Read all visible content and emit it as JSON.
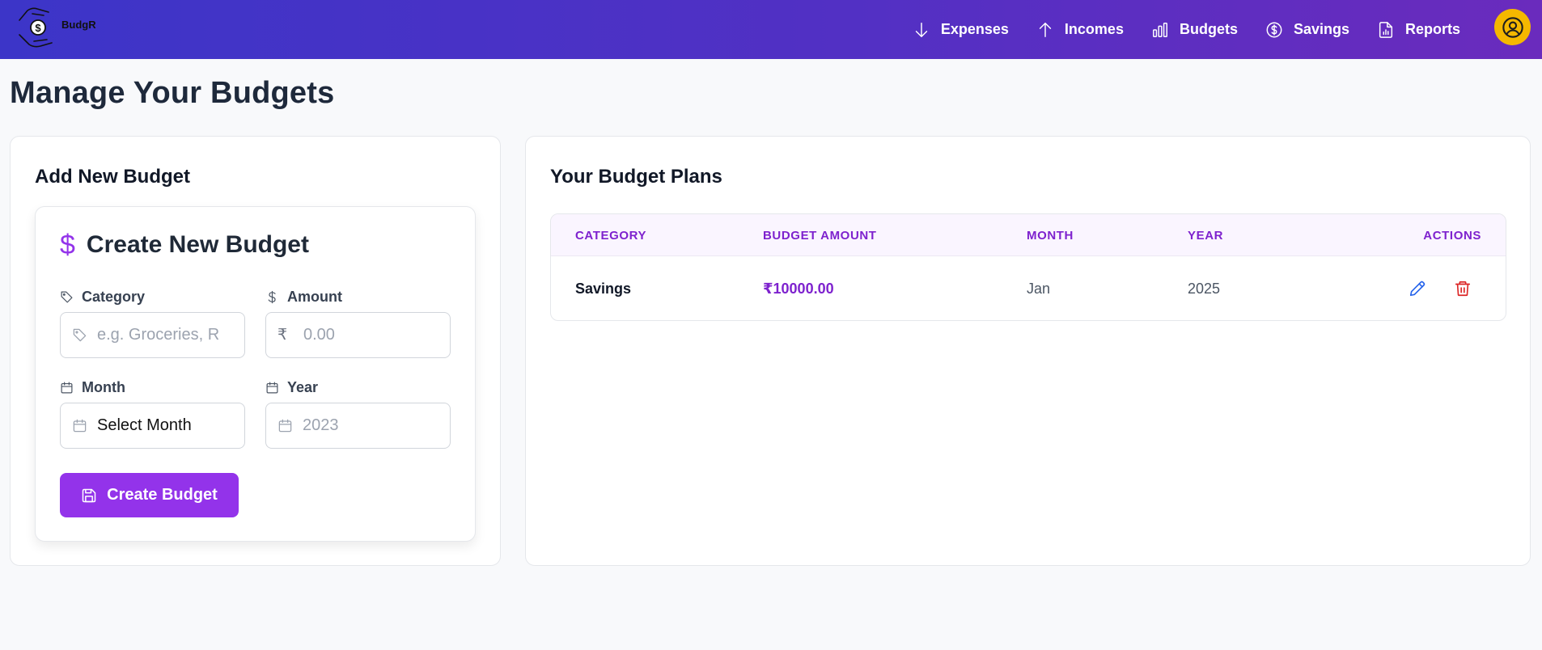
{
  "brand": {
    "name": "BudgR"
  },
  "nav": {
    "items": [
      {
        "label": "Expenses",
        "icon": "arrow-down-icon"
      },
      {
        "label": "Incomes",
        "icon": "arrow-up-icon"
      },
      {
        "label": "Budgets",
        "icon": "bar-chart-icon"
      },
      {
        "label": "Savings",
        "icon": "dollar-circle-icon"
      },
      {
        "label": "Reports",
        "icon": "report-file-icon"
      }
    ],
    "avatar_icon": "user-circle-icon"
  },
  "page": {
    "title": "Manage Your Budgets"
  },
  "add_budget": {
    "heading": "Add New Budget",
    "form": {
      "title_icon": "$",
      "title": "Create New Budget",
      "category": {
        "label": "Category",
        "placeholder": "e.g. Groceries, Rent",
        "value": ""
      },
      "amount": {
        "label": "Amount",
        "currency_symbol": "₹",
        "placeholder": "0.00",
        "value": ""
      },
      "month": {
        "label": "Month",
        "selected": "Select Month"
      },
      "year": {
        "label": "Year",
        "placeholder": "2023",
        "value": ""
      },
      "submit_label": "Create Budget"
    }
  },
  "budget_plans": {
    "heading": "Your Budget Plans",
    "columns": [
      "CATEGORY",
      "BUDGET AMOUNT",
      "MONTH",
      "YEAR",
      "ACTIONS"
    ],
    "rows": [
      {
        "category": "Savings",
        "amount": "₹10000.00",
        "month": "Jan",
        "year": "2025"
      }
    ]
  },
  "colors": {
    "accent": "#9333ea",
    "nav_gradient_start": "#3c35c8",
    "nav_gradient_end": "#6a2bbd",
    "avatar": "#f5b800",
    "edit": "#2563eb",
    "delete": "#dc2626"
  }
}
